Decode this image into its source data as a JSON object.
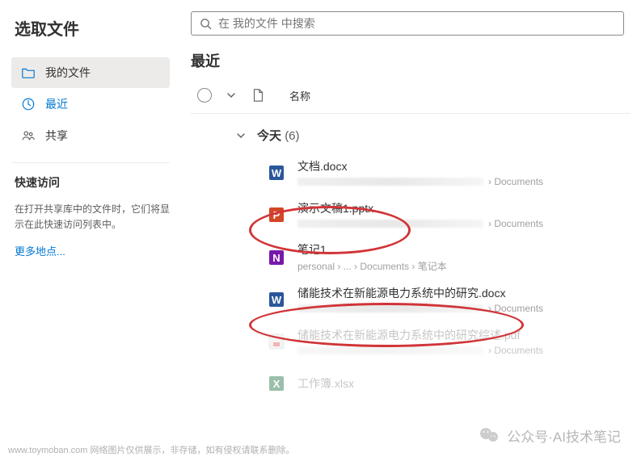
{
  "header": {
    "title": "选取文件"
  },
  "search": {
    "placeholder": "在 我的文件 中搜索"
  },
  "sidebar": {
    "items": [
      {
        "label": "我的文件"
      },
      {
        "label": "最近"
      },
      {
        "label": "共享"
      }
    ],
    "quick": {
      "title": "快速访问",
      "description": "在打开共享库中的文件时，它们将显示在此快速访问列表中。",
      "more": "更多地点..."
    }
  },
  "main": {
    "section_title": "最近",
    "column_name": "名称",
    "group": {
      "label": "今天",
      "count": "(6)"
    },
    "files": [
      {
        "name": "文档.docx",
        "path_end": "› Documents",
        "app": "word"
      },
      {
        "name": "演示文稿1.pptx",
        "path_end": "› Documents",
        "app": "powerpoint"
      },
      {
        "name": "笔记1",
        "path_visible": "personal › ... › Documents › 笔记本",
        "app": "onenote"
      },
      {
        "name": "储能技术在新能源电力系统中的研究.docx",
        "path_end": "› Documents",
        "app": "word"
      },
      {
        "name": "储能技术在新能源电力系统中的研究综述.pdf",
        "path_end": "› Documents",
        "app": "pdf",
        "dim": true
      },
      {
        "name": "工作簿.xlsx",
        "path_end": "",
        "app": "excel",
        "dim": true
      }
    ]
  },
  "footer": {
    "text": "www.toymoban.com 网络图片仅供展示，非存储，如有侵权请联系删除。"
  },
  "watermark": {
    "text": "公众号·AI技术笔记"
  }
}
